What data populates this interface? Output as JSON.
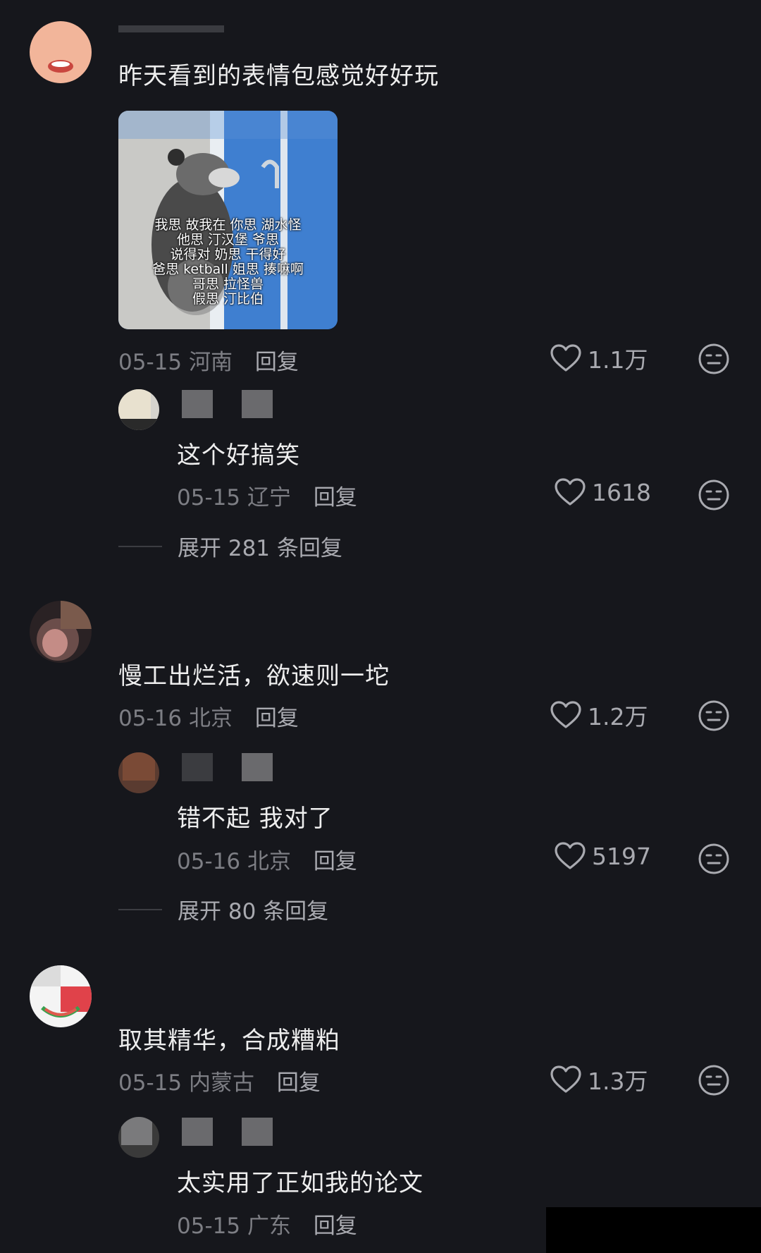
{
  "comments": [
    {
      "text": "昨天看到的表情包感觉好好玩",
      "meta_date": "05-15",
      "meta_location": "河南",
      "reply_label": "回复",
      "likes": "1.1万",
      "image_caption": [
        "我思 故我在 你思 湖水怪",
        "他思 汀汉堡 爷思",
        "说得对 奶思 干得好",
        "爸思 ketball 姐思 揍嘛啊",
        "哥思 拉怪兽",
        "假思 汀比伯"
      ],
      "sub_reply": {
        "text": "这个好搞笑",
        "meta_date": "05-15",
        "meta_location": "辽宁",
        "reply_label": "回复",
        "likes": "1618"
      },
      "expand_label": "展开 281 条回复"
    },
    {
      "text": "慢工出烂活，欲速则一坨",
      "meta_date": "05-16",
      "meta_location": "北京",
      "reply_label": "回复",
      "likes": "1.2万",
      "sub_reply": {
        "text": "错不起 我对了",
        "meta_date": "05-16",
        "meta_location": "北京",
        "reply_label": "回复",
        "likes": "5197"
      },
      "expand_label": "展开 80 条回复"
    },
    {
      "text": "取其精华，合成糟粕",
      "meta_date": "05-15",
      "meta_location": "内蒙古",
      "reply_label": "回复",
      "likes": "1.3万",
      "sub_reply": {
        "text": "太实用了正如我的论文",
        "meta_date": "05-15",
        "meta_location": "广东",
        "reply_label": "回复"
      }
    }
  ],
  "icons": {
    "like": "heart-outline-icon",
    "dislike": "neutral-face-icon"
  },
  "colors": {
    "background": "#16171c",
    "primary_text": "#eeeeee",
    "secondary_text": "#7d7e84",
    "action_text": "#a9aab0"
  }
}
